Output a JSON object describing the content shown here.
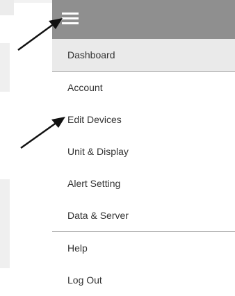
{
  "menu_icon": "hamburger-menu-icon",
  "menu": {
    "dashboard": "Dashboard",
    "account": "Account",
    "edit_devices": "Edit Devices",
    "unit_display": "Unit & Display",
    "alert_setting": "Alert Setting",
    "data_server": "Data & Server",
    "help": "Help",
    "log_out": "Log Out"
  },
  "colors": {
    "app_bar": "#8f8f8f",
    "active_item": "#eaeaea",
    "text": "#333333"
  }
}
